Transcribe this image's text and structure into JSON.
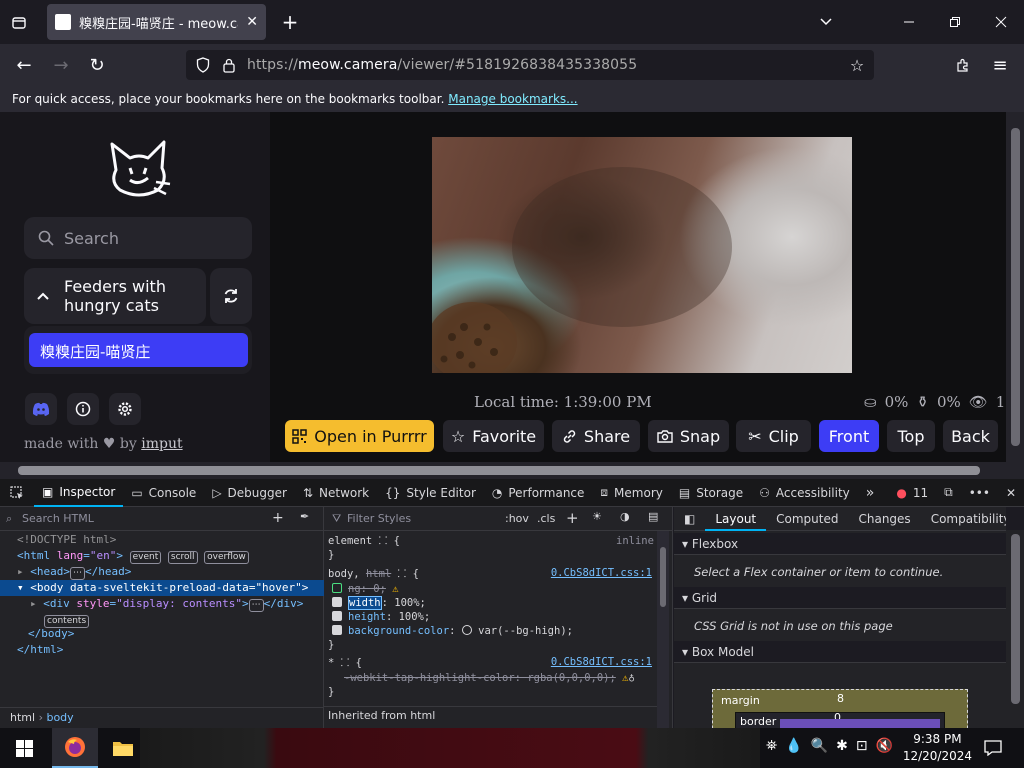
{
  "browser": {
    "tab_title": "糗糗庄园-喵贤庄 - meow.camera",
    "url_prefix": "https://",
    "url_domain": "meow.camera",
    "url_path": "/viewer/#5181926838435338055",
    "bookmarks_text": "For quick access, place your bookmarks here on the bookmarks toolbar.",
    "bookmarks_link": "Manage bookmarks..."
  },
  "page": {
    "search_placeholder": "Search",
    "feeders_label_1": "Feeders with",
    "feeders_label_2": "hungry cats",
    "feeder_active": "糗糗庄园-喵贤庄",
    "made_with": "made with",
    "made_by": "by",
    "author": "imput",
    "local_time": "Local time: 1:39:00 PM",
    "stat_food": "0%",
    "stat_water": "0%",
    "stat_viewers": "1",
    "buttons": {
      "purrrr": "Open in Purrrr",
      "favorite": "Favorite",
      "share": "Share",
      "snap": "Snap",
      "clip": "Clip",
      "front": "Front",
      "top": "Top",
      "back": "Back"
    }
  },
  "devtools": {
    "tabs": [
      "Inspector",
      "Console",
      "Debugger",
      "Network",
      "Style Editor",
      "Performance",
      "Memory",
      "Storage",
      "Accessibility"
    ],
    "error_count": "11",
    "search_html": "Search HTML",
    "tree": {
      "doctype": "<!DOCTYPE html>",
      "html_open": "<html",
      "html_lang_attr": "lang",
      "html_lang_val": "\"en\"",
      "head": "<head>",
      "head_close": "</head>",
      "body_open": "<body",
      "body_attr": "data-sveltekit-preload-data",
      "body_val": "\"hover\"",
      "div_open": "<div",
      "div_attr": "style",
      "div_val": "\"display: contents\"",
      "div_close": "</div>",
      "body_close": "</body>",
      "html_close": "</html>",
      "badge_event": "event",
      "badge_scroll": "scroll",
      "badge_overflow": "overflow",
      "badge_contents": "contents",
      "badge_ellipsis": "⋯"
    },
    "breadcrumb": [
      "html",
      "body"
    ],
    "filter_styles": "Filter Styles",
    "hov": ":hov",
    "cls": ".cls",
    "rules": {
      "element_selector": "element",
      "inline": "inline",
      "body_selector": "body,",
      "body_selector_strike": "html",
      "src1": "0.CbS8dICT.css:1",
      "decl_disabled": "ng: 0;",
      "prop_width": "width",
      "val_width": " 100%;",
      "prop_height": "height",
      "val_height": " 100%;",
      "prop_bg": "background-color",
      "val_bg": "var(--bg-high);",
      "star_selector": "*",
      "src2": "0.CbS8dICT.css:1",
      "webkit_rule": "-webkit-tap-highlight-color: rgba(0,0,0,0);",
      "inherited": "Inherited from html"
    },
    "layout_tabs": [
      "Layout",
      "Computed",
      "Changes",
      "Compatibility"
    ],
    "flexbox": "Flexbox",
    "flexbox_note": "Select a Flex container or item to continue.",
    "grid": "Grid",
    "grid_note": "CSS Grid is not in use on this page",
    "box_model": "Box Model",
    "margin_label": "margin",
    "margin_val": "8",
    "border_label": "border",
    "border_val": "0"
  },
  "taskbar": {
    "time": "9:38 PM",
    "date": "12/20/2024"
  }
}
